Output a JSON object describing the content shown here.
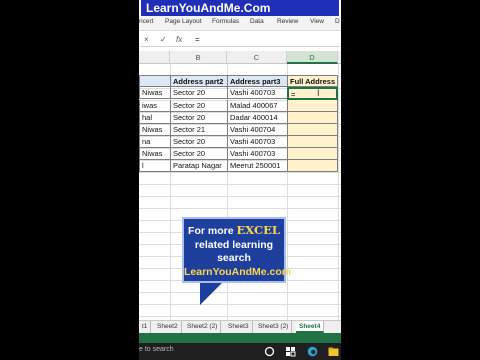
{
  "banner": {
    "text": "LearnYouAndMe.Com"
  },
  "ribbon": {
    "tabs": [
      "ncert",
      "Page Layout",
      "Formulas",
      "Data",
      "Review",
      "View",
      "D"
    ]
  },
  "formula_bar": {
    "cancel": "×",
    "enter": "✓",
    "fx": "fx",
    "content": "="
  },
  "columns": [
    "B",
    "C",
    "D"
  ],
  "headers": {
    "col_a": "",
    "address2": "Address part2",
    "address3": "Address part3",
    "full": "Full Address"
  },
  "rows": [
    {
      "a": "Niwas",
      "b": "Sector 20",
      "c": "Vashi 400703",
      "d": "="
    },
    {
      "a": "iwas",
      "b": "Sector 20",
      "c": "Malad 400067",
      "d": ""
    },
    {
      "a": "hal",
      "b": "Sector 20",
      "c": "Dadar 400014",
      "d": ""
    },
    {
      "a": "Niwas",
      "b": "Sector 21",
      "c": "Vashi 400704",
      "d": ""
    },
    {
      "a": "na",
      "b": "Sector 20",
      "c": "Vashi 400703",
      "d": ""
    },
    {
      "a": "Niwas",
      "b": "Sector 20",
      "c": "Vashi 400703",
      "d": ""
    },
    {
      "a": "l",
      "b": "Paratap Nagar",
      "c": "Meerut 250001",
      "d": ""
    }
  ],
  "callout": {
    "line1": "For more",
    "excel": "EXCEL",
    "line2": "related learning",
    "line3": "search",
    "url": "LearnYouAndMe.com"
  },
  "sheets": [
    "t1",
    "Sheet2",
    "Sheet2 (2)",
    "Sheet3",
    "Sheet3 (2)",
    "Sheet4"
  ],
  "active_sheet": "Sheet4",
  "taskbar": {
    "search": "e to search"
  },
  "colors": {
    "excel_green": "#217346",
    "banner_blue": "#1f2fb8",
    "header_fill": "#dde8f6",
    "input_fill": "#fff2cc"
  }
}
